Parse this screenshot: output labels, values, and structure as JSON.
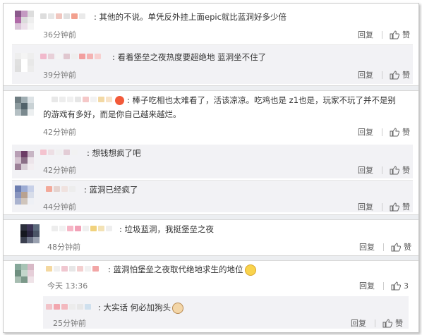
{
  "colors": {
    "accent_gold": "#d7a13a",
    "badge_red": "#f25a3a",
    "reply_bg": "#f2f2f5",
    "separator": "#eceef1"
  },
  "actions": {
    "reply": "回复",
    "like": "赞"
  },
  "groups": [
    {
      "comments": [
        {
          "text": ": 其他的不说。单凭反外挂上面epic就比蓝洞好多少倍",
          "time": "36分钟前",
          "like": "赞"
        },
        {
          "text": ": 看着堡垒之夜热度要超绝地 蓝洞坐不住了",
          "time": "39分钟前",
          "like": "赞"
        }
      ]
    },
    {
      "comments": [
        {
          "badge": "红",
          "text": ": 棒子吃相也太难看了，活该凉凉。吃鸡也是 z1也是，玩家不玩了并不是别的游戏有多好，而是你自己越来越烂。",
          "time": "42分钟前",
          "like": "赞"
        },
        {
          "text": ": 想钱想疯了吧",
          "time": "42分钟前",
          "like": "赞"
        },
        {
          "text": ": 蓝洞已经疯了",
          "time": "44分钟前",
          "like": "赞"
        }
      ]
    },
    {
      "comments": [
        {
          "text": ": 垃圾蓝洞，我挺堡垒之夜",
          "time": "48分钟前",
          "like": "赞"
        }
      ]
    },
    {
      "comments": [
        {
          "text": ": 蓝洞怕堡垒之夜取代绝地求生的地位",
          "emoji": "face-emoji",
          "time": "今天 13:36",
          "like": "3"
        },
        {
          "text": ": 大实话 何必加狗头",
          "emoji": "dog-emoji",
          "time": "25分钟前",
          "like": "赞"
        }
      ]
    }
  ]
}
